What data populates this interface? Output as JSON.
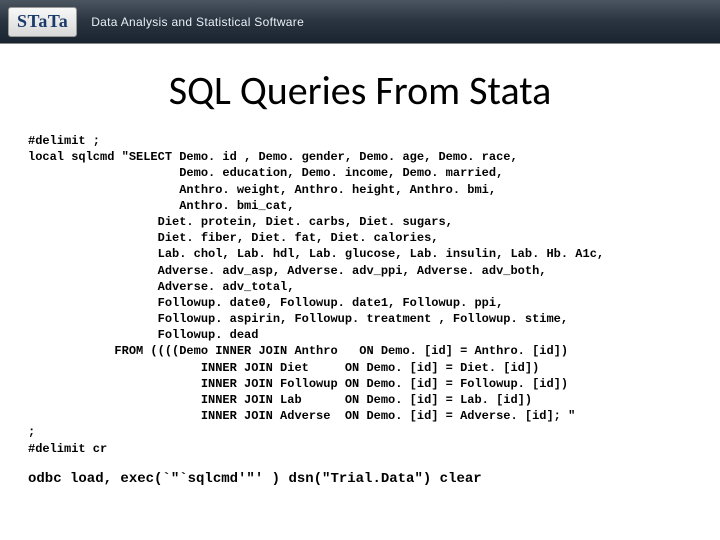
{
  "header": {
    "logo": "STaTa",
    "tagline": "Data Analysis and Statistical Software"
  },
  "title": "SQL Queries From Stata",
  "code": {
    "l01": "#delimit ;",
    "l02": "local sqlcmd \"SELECT Demo. id , Demo. gender, Demo. age, Demo. race,",
    "l03": "                     Demo. education, Demo. income, Demo. married,",
    "l04": "                     Anthro. weight, Anthro. height, Anthro. bmi,",
    "l05": "                     Anthro. bmi_cat,",
    "l06": "                  Diet. protein, Diet. carbs, Diet. sugars,",
    "l07": "                  Diet. fiber, Diet. fat, Diet. calories,",
    "l08": "                  Lab. chol, Lab. hdl, Lab. glucose, Lab. insulin, Lab. Hb. A1c,",
    "l09": "                  Adverse. adv_asp, Adverse. adv_ppi, Adverse. adv_both,",
    "l10": "                  Adverse. adv_total,",
    "l11": "                  Followup. date0, Followup. date1, Followup. ppi,",
    "l12": "                  Followup. aspirin, Followup. treatment , Followup. stime,",
    "l13": "                  Followup. dead",
    "l14": "            FROM ((((Demo INNER JOIN Anthro   ON Demo. [id] = Anthro. [id])",
    "l15": "                        INNER JOIN Diet     ON Demo. [id] = Diet. [id])",
    "l16": "                        INNER JOIN Followup ON Demo. [id] = Followup. [id])",
    "l17": "                        INNER JOIN Lab      ON Demo. [id] = Lab. [id])",
    "l18": "                        INNER JOIN Adverse  ON Demo. [id] = Adverse. [id]; \"",
    "l19": ";",
    "l20": "#delimit cr"
  },
  "footer_cmd": "odbc load, exec(`\"`sqlcmd'\"' ) dsn(\"Trial.Data\") clear"
}
